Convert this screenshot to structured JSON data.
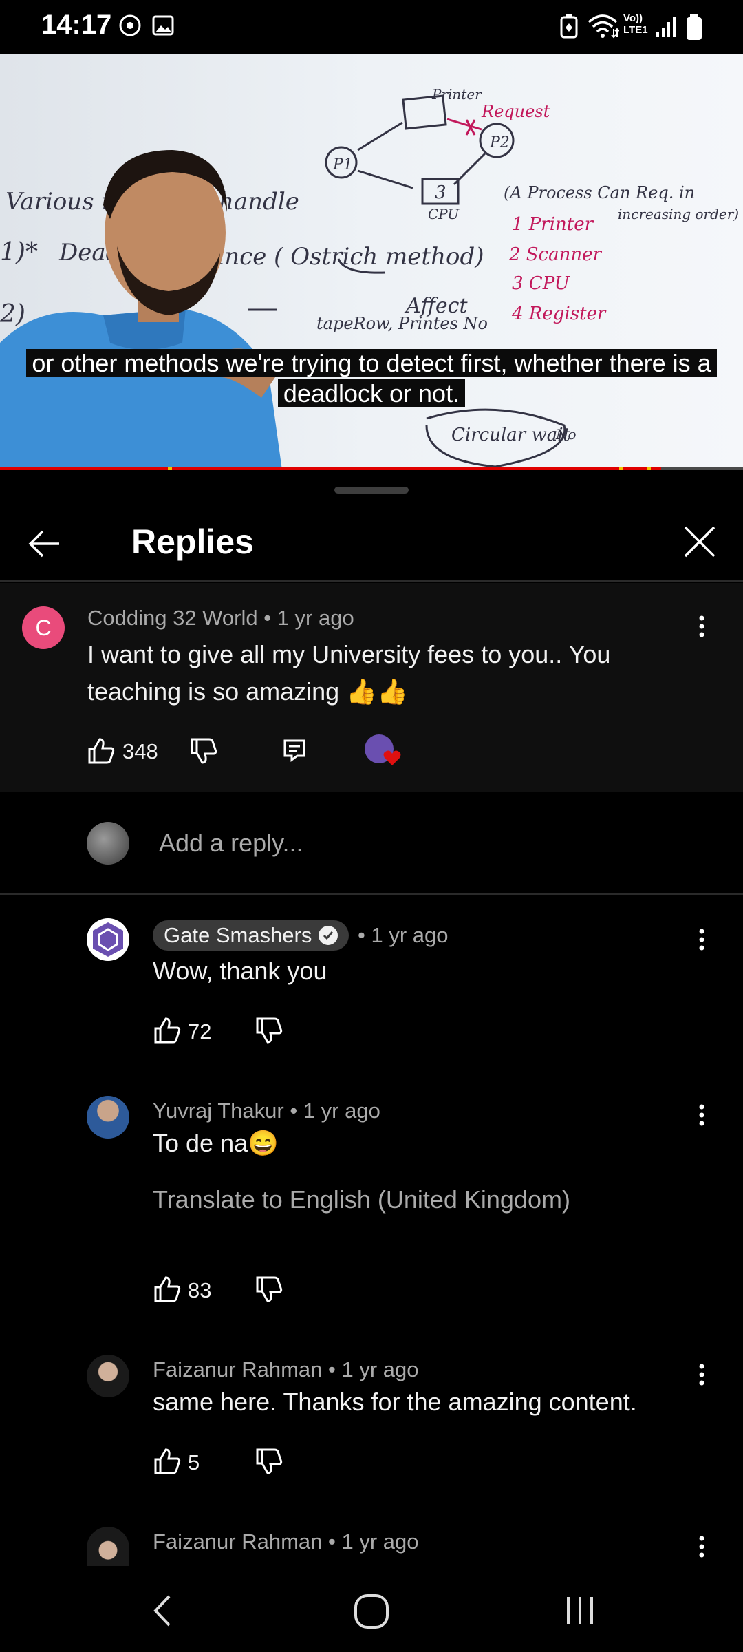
{
  "status_bar": {
    "time": "14:17",
    "network": "Vo)) LTE1"
  },
  "video": {
    "caption_line1": "or other methods we're trying to detect first, whether there is a",
    "caption_line2": "deadlock or not.",
    "board": {
      "printer": "Printer",
      "request": "Request",
      "p1": "P1",
      "p2": "P2",
      "three": "3",
      "cpu": "CPU",
      "various": "Various m",
      "handle": "handle",
      "star": "1)*",
      "deadlock": "Deadlo",
      "ance": "ance ( Ostrich method)",
      "two": "2)",
      "affect": "Affect",
      "taperpoint": "tapeRow, Printes No",
      "process_note": "(A Process Can Req. in",
      "increasing": "increasing order)",
      "list1": "1  Printer",
      "list2": "2  Scanner",
      "list3": "3  CPU",
      "list4": "4  Register",
      "circular": "Circular wait",
      "no": "No"
    },
    "progress_fraction": 0.89
  },
  "panel": {
    "title": "Replies",
    "top_comment": {
      "avatar_letter": "C",
      "author": "Codding 32 World",
      "time": "1 yr ago",
      "text_line1": "I want to give all my University fees to you.. You",
      "text_line2": "teaching is so amazing 👍👍",
      "likes": "348"
    },
    "reply_input": {
      "placeholder": "Add a reply..."
    },
    "replies": [
      {
        "author": "Gate Smashers",
        "time": "• 1 yr ago",
        "text": "Wow, thank you",
        "likes": "72"
      },
      {
        "author": "Yuvraj Thakur",
        "time": "1 yr ago",
        "text": "To de na😄",
        "translate": "Translate to English (United Kingdom)",
        "likes": "83"
      },
      {
        "author": "Faizanur Rahman",
        "time": "1 yr ago",
        "text": "same here. Thanks for the amazing content.",
        "likes": "5"
      },
      {
        "author": "Faizanur Rahman",
        "time": "1 yr ago"
      }
    ]
  },
  "colors": {
    "accent_red": "#e00000",
    "avatar_pink": "#e94b7b",
    "background": "#000000",
    "muted": "#aaaaaa"
  }
}
